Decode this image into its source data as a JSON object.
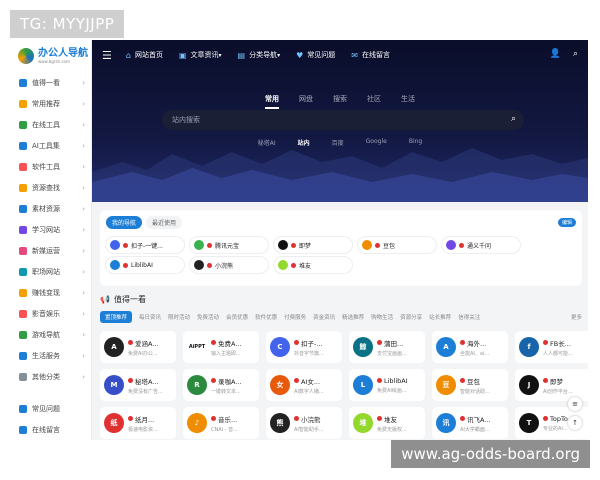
{
  "overlay": {
    "tg": "TG: MYYJJPP",
    "url": "www.ag-odds-board.org"
  },
  "logo": {
    "title": "办公人导航",
    "subtitle": "www.bgrsh.com"
  },
  "sidebar": {
    "items": [
      {
        "label": "值得一看",
        "icon": "megaphone-icon",
        "color": "#1c7ed6"
      },
      {
        "label": "常用推荐",
        "icon": "thumb-icon",
        "color": "#f59f00"
      },
      {
        "label": "在线工具",
        "icon": "tools-icon",
        "color": "#2f9e44"
      },
      {
        "label": "AI工具集",
        "icon": "robot-icon",
        "color": "#1c7ed6"
      },
      {
        "label": "软件工具",
        "icon": "software-icon",
        "color": "#fa5252"
      },
      {
        "label": "资源查找",
        "icon": "search-icon",
        "color": "#f59f00"
      },
      {
        "label": "素材资源",
        "icon": "image-icon",
        "color": "#1c7ed6"
      },
      {
        "label": "学习网站",
        "icon": "book-icon",
        "color": "#7048e8"
      },
      {
        "label": "新媒运营",
        "icon": "media-icon",
        "color": "#e64980"
      },
      {
        "label": "职场网站",
        "icon": "briefcase-icon",
        "color": "#1098ad"
      },
      {
        "label": "赚钱变现",
        "icon": "money-icon",
        "color": "#f59f00"
      },
      {
        "label": "影音娱乐",
        "icon": "video-icon",
        "color": "#fa5252"
      },
      {
        "label": "游戏导航",
        "icon": "game-icon",
        "color": "#2f9e44"
      },
      {
        "label": "生活服务",
        "icon": "life-icon",
        "color": "#1c7ed6"
      },
      {
        "label": "其他分类",
        "icon": "grid-icon",
        "color": "#868e96"
      }
    ],
    "bottom": [
      {
        "label": "常见问题",
        "icon": "question-icon",
        "color": "#1c7ed6"
      },
      {
        "label": "在线留言",
        "icon": "message-icon",
        "color": "#1c7ed6"
      }
    ]
  },
  "topnav": {
    "items": [
      {
        "label": "网站首页",
        "icon": "home-icon"
      },
      {
        "label": "文章资讯",
        "icon": "article-icon",
        "dropdown": true
      },
      {
        "label": "分类导航",
        "icon": "category-icon",
        "dropdown": true
      },
      {
        "label": "常见问题",
        "icon": "heart-icon"
      },
      {
        "label": "在线留言",
        "icon": "message-icon"
      }
    ]
  },
  "search": {
    "tabs": [
      "常用",
      "网盘",
      "搜索",
      "社区",
      "生活"
    ],
    "active_tab": 0,
    "placeholder": "站内搜索",
    "engines": [
      "秘塔AI",
      "站内",
      "百度",
      "Google",
      "Bing"
    ],
    "active_engine": 1
  },
  "mynav": {
    "tabs": [
      "我的导航",
      "最近使用"
    ],
    "more": "编辑",
    "items": [
      {
        "label": "扣子-一键...",
        "color": "#4263eb"
      },
      {
        "label": "腾讯元宝",
        "color": "#37b24d"
      },
      {
        "label": "即梦",
        "color": "#111111"
      },
      {
        "label": "豆包",
        "color": "#f08c00"
      },
      {
        "label": "通义千问",
        "color": "#7048e8"
      },
      {
        "label": "LiblibAI",
        "color": "#1c7ed6"
      },
      {
        "label": "小浣熊",
        "color": "#222222"
      },
      {
        "label": "堆友",
        "color": "#94d82d"
      }
    ]
  },
  "section": {
    "title": "值得一看",
    "tabs": [
      "置顶推荐",
      "每日资讯",
      "限时活动",
      "免费活动",
      "会员优惠",
      "软件优惠",
      "付费服务",
      "资金资讯",
      "精选推荐",
      "购物生活",
      "资源分享",
      "站长推荐",
      "信得关注"
    ],
    "more": "更多"
  },
  "cards": [
    {
      "title": "爱涵A...",
      "desc": "免费AI办公...",
      "color": "#222222",
      "mark": "A"
    },
    {
      "title": "免费A...",
      "desc": "输入主题即...",
      "color": "#ffffff",
      "mark": "AiPPT",
      "dark_text": true
    },
    {
      "title": "扣子-...",
      "desc": "抖音字节旗...",
      "color": "#4263eb",
      "mark": "C"
    },
    {
      "title": "蒲田...",
      "desc": "支付宝画画...",
      "color": "#0b7285",
      "mark": "鲸"
    },
    {
      "title": "海外...",
      "desc": "全能AI、ai...",
      "color": "#1c7ed6",
      "mark": "A"
    },
    {
      "title": "FB长...",
      "desc": "人人都可能...",
      "color": "#1864ab",
      "mark": "f"
    },
    {
      "title": "秘塔A...",
      "desc": "免费没有广告...",
      "color": "#364fc7",
      "mark": "M"
    },
    {
      "title": "录咖A...",
      "desc": "一键转文本...",
      "color": "#2b8a3e",
      "mark": "R"
    },
    {
      "title": "AI女...",
      "desc": "AI数字人播...",
      "color": "#e8590c",
      "mark": "女"
    },
    {
      "title": "LiblibAI",
      "desc": "免费AI绘画...",
      "color": "#1c7ed6",
      "mark": "L"
    },
    {
      "title": "豆包",
      "desc": "智能对话助...",
      "color": "#f08c00",
      "mark": "豆"
    },
    {
      "title": "即梦",
      "desc": "AI创作平台...",
      "color": "#111111",
      "mark": "J"
    },
    {
      "title": "纸月...",
      "desc": "极速电影资...",
      "color": "#e03131",
      "mark": "纸"
    },
    {
      "title": "音乐...",
      "desc": "CNAI - 音...",
      "color": "#f08c00",
      "mark": "♪"
    },
    {
      "title": "小浣熊",
      "desc": "AI智能助手...",
      "color": "#222222",
      "mark": "熊"
    },
    {
      "title": "堆友",
      "desc": "免费无版权...",
      "color": "#94d82d",
      "mark": "堆"
    },
    {
      "title": "讯飞A...",
      "desc": "AI大学霸面...",
      "color": "#1c7ed6",
      "mark": "讯"
    },
    {
      "title": "TopTo...",
      "desc": "专业的AI...",
      "color": "#111111",
      "mark": "T"
    }
  ]
}
